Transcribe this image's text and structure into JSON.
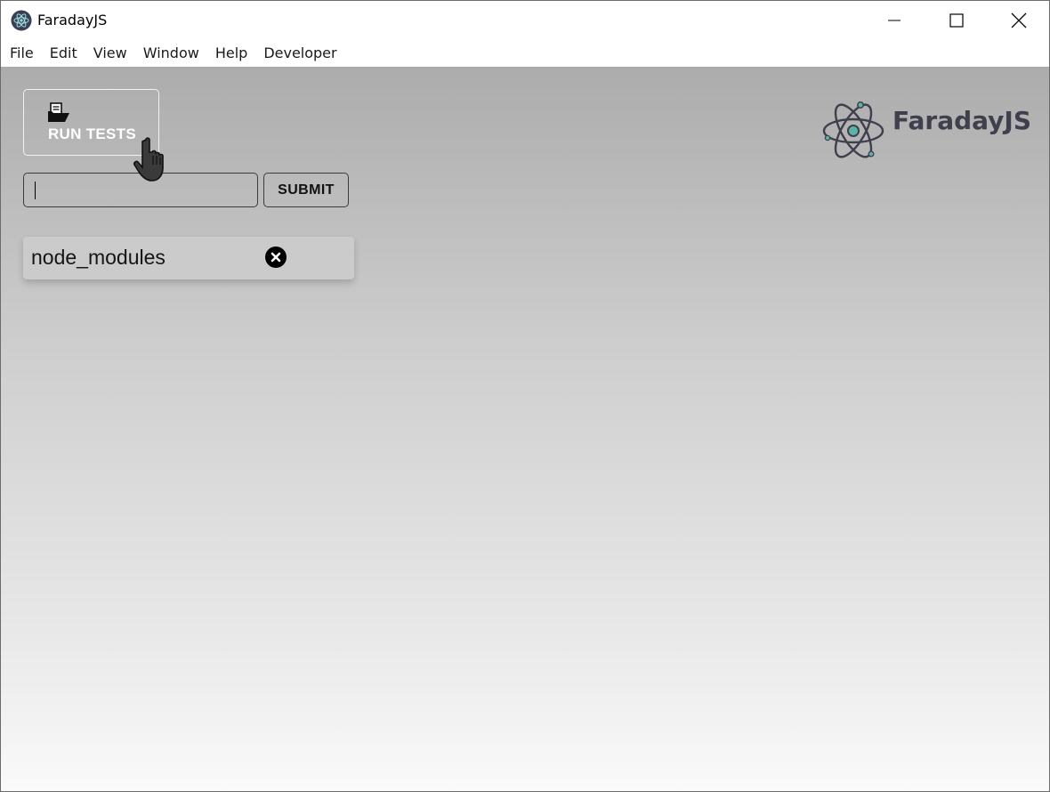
{
  "window": {
    "title": "FaradayJS",
    "controls": [
      "minimize-icon",
      "maximize-icon",
      "close-icon"
    ]
  },
  "menubar": {
    "items": [
      "File",
      "Edit",
      "View",
      "Window",
      "Help",
      "Developer"
    ]
  },
  "toolbar": {
    "run_tests_label": "RUN TESTS",
    "run_tests_icon": "folder-open-icon"
  },
  "path_form": {
    "input_value": "",
    "submit_label": "SUBMIT"
  },
  "folders": [
    {
      "label": "node_modules",
      "remove_icon": "close-circle-icon"
    }
  ],
  "brand": {
    "name": "FaradayJS",
    "logo_icon": "atom-icon",
    "accent_color": "#5cb5a4",
    "text_color": "#3f3f4d"
  }
}
